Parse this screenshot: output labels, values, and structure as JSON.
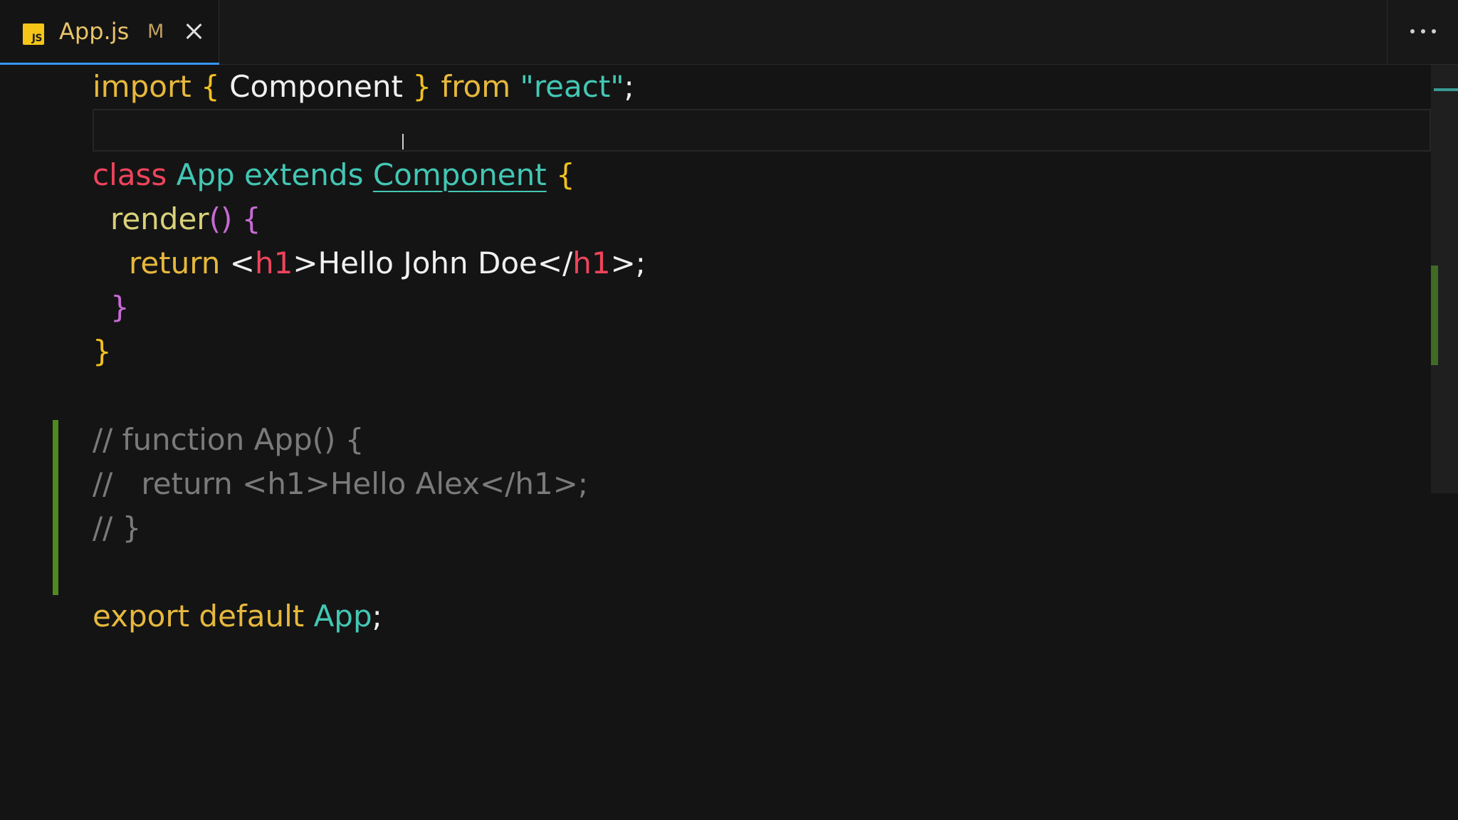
{
  "tab": {
    "filename": "App.js",
    "icon_text": "JS",
    "status": "M"
  },
  "code": {
    "line1": {
      "import": "import",
      "open": " { ",
      "component": "Component",
      "close": " } ",
      "from": "from",
      "space": " ",
      "module": "\"react\"",
      "semi": ";"
    },
    "line3": {
      "class": "class",
      "app": "App",
      "extends": "extends",
      "component": "Component",
      "brace": "{"
    },
    "line4": {
      "render": "render",
      "paren": "()",
      "brace": "{"
    },
    "line5": {
      "return": "return",
      "lt1": " <",
      "tag1": "h1",
      "gt1": ">",
      "text": "Hello John Doe",
      "lt2": "</",
      "tag2": "h1",
      "gt2": ">;"
    },
    "line6": {
      "brace": "}"
    },
    "line7": {
      "brace": "}"
    },
    "comment1": "// function App() {",
    "comment2": "//   return <h1>Hello Alex</h1>;",
    "comment3": "// }",
    "line12": {
      "export": "export",
      "default": "default",
      "app": "App",
      "semi": ";"
    }
  },
  "colors": {
    "keyword": "#e6b83d",
    "string": "#43c7b4",
    "tag": "#f0445c",
    "comment": "#7a7a7a",
    "tab_accent": "#3794ff",
    "diff_added": "#4e8a1e"
  },
  "icons": {
    "close": "close-icon",
    "more": "ellipsis-icon",
    "file": "javascript-file-icon"
  }
}
